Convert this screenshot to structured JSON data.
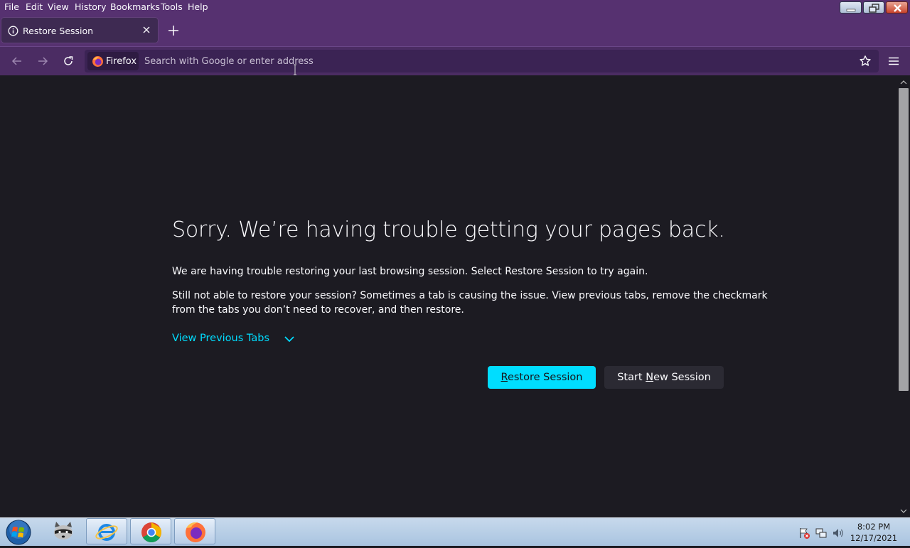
{
  "menu": [
    "File",
    "Edit",
    "View",
    "History",
    "Bookmarks",
    "Tools",
    "Help"
  ],
  "tab": {
    "title": "Restore Session"
  },
  "urlbar": {
    "identity_label": "Firefox",
    "placeholder": "Search with Google or enter address",
    "value": ""
  },
  "page": {
    "heading": "Sorry. We’re having trouble getting your pages back.",
    "paragraph1": "We are having trouble restoring your last browsing session. Select Restore Session to try again.",
    "paragraph2_line1": "Still not able to restore your session? Sometimes a tab is causing the issue. View previous tabs, remove the checkmark",
    "paragraph2_line2": "from the tabs you don’t need to recover, and then restore.",
    "view_previous_tabs": "View Previous Tabs",
    "restore_button": {
      "pre": "",
      "accel": "R",
      "post": "estore Session"
    },
    "new_session_button": {
      "pre": "Start ",
      "accel": "N",
      "post": "ew Session"
    }
  },
  "taskbar": {
    "items": [
      "raccoon-app-icon",
      "internet-explorer-icon",
      "chrome-icon",
      "firefox-icon"
    ],
    "clock_time": "8:02 PM",
    "clock_date": "12/17/2021"
  },
  "colors": {
    "accent": "#00ddff",
    "chrome_purple": "#563170",
    "content_bg": "#1c1b22"
  }
}
